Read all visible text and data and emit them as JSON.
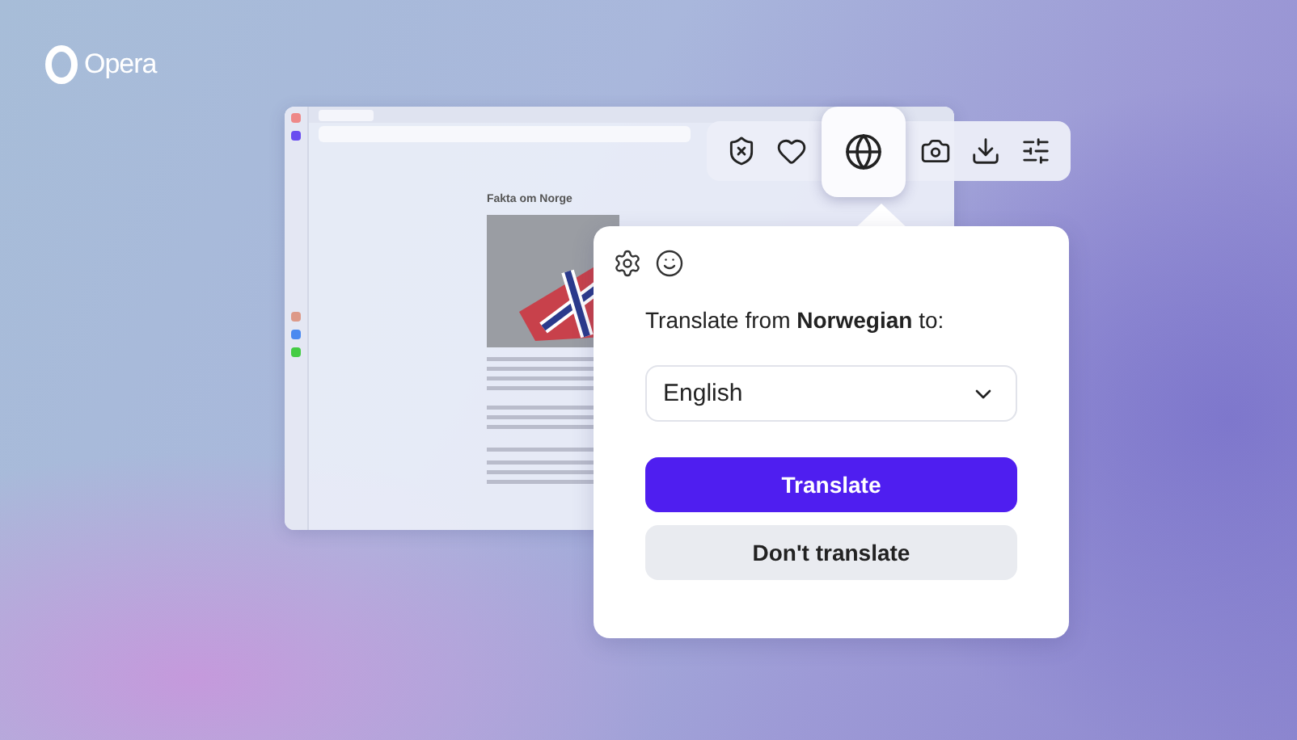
{
  "brand": {
    "name": "Opera"
  },
  "browser": {
    "article_title": "Fakta om Norge"
  },
  "toolbar": {
    "buttons": [
      {
        "kind": "shield",
        "selected": false
      },
      {
        "kind": "heart",
        "selected": false
      },
      {
        "kind": "translate",
        "selected": true
      },
      {
        "kind": "camera",
        "selected": false
      },
      {
        "kind": "download",
        "selected": false
      },
      {
        "kind": "settings",
        "selected": false
      }
    ]
  },
  "popup": {
    "prompt": "Translate from **Norwegian** to:",
    "language_select": {
      "value": "English"
    },
    "buttons": [
      {
        "label": "Translate",
        "kind": "primary"
      },
      {
        "label": "Don't translate",
        "kind": "secondary"
      }
    ]
  }
}
